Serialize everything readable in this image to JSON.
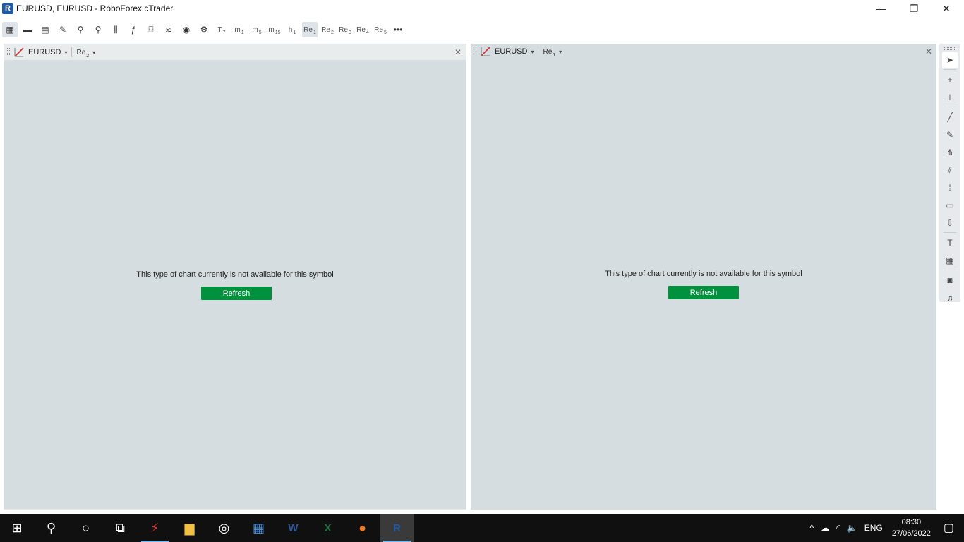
{
  "window": {
    "title": "EURUSD, EURUSD - RoboForex cTrader",
    "icon_letter": "R",
    "minimize": "—",
    "restore": "❐",
    "close": "✕"
  },
  "toolbar": {
    "tools": [
      {
        "icon": "multi-chart-icon",
        "glyph": "▦"
      },
      {
        "icon": "single-chart-icon",
        "glyph": "▬"
      },
      {
        "icon": "layout-icon",
        "glyph": "▤"
      },
      {
        "icon": "chart-settings-icon",
        "glyph": "✎"
      },
      {
        "icon": "zoom-out-icon",
        "glyph": "⚲"
      },
      {
        "icon": "zoom-in-icon",
        "glyph": "⚲"
      },
      {
        "icon": "chart-type-icon",
        "glyph": "⫼"
      },
      {
        "icon": "indicators-icon",
        "glyph": "ƒ"
      },
      {
        "icon": "robots-icon",
        "glyph": "⌼"
      },
      {
        "icon": "layers-icon",
        "glyph": "≋"
      },
      {
        "icon": "watch-icon",
        "glyph": "◉"
      },
      {
        "icon": "template-icon",
        "glyph": "⚙"
      }
    ],
    "periods": [
      {
        "label": "T",
        "sub": "7"
      },
      {
        "label": "m",
        "sub": "1"
      },
      {
        "label": "m",
        "sub": "5"
      },
      {
        "label": "m",
        "sub": "15"
      },
      {
        "label": "h",
        "sub": "1"
      },
      {
        "label": "Re",
        "sub": "1",
        "active": true
      },
      {
        "label": "Re",
        "sub": "2"
      },
      {
        "label": "Re",
        "sub": "3"
      },
      {
        "label": "Re",
        "sub": "4"
      },
      {
        "label": "Re",
        "sub": "5"
      }
    ],
    "more": "•••"
  },
  "panes": [
    {
      "symbol": "EURUSD",
      "period": "Re",
      "period_sub": "2",
      "message": "This type of chart currently is not available for this symbol",
      "button": "Refresh",
      "close": "✕"
    },
    {
      "symbol": "EURUSD",
      "period": "Re",
      "period_sub": "1",
      "message": "This type of chart currently is not available for this symbol",
      "button": "Refresh",
      "close": "✕"
    }
  ],
  "caret": "▾",
  "side_tools": [
    {
      "icon": "cursor-icon",
      "glyph": "➤",
      "active": true
    },
    {
      "icon": "crosshair-icon",
      "glyph": "+"
    },
    {
      "icon": "measure-icon",
      "glyph": "⊥"
    },
    {
      "icon": "trendline-icon",
      "glyph": "╱"
    },
    {
      "icon": "pen-icon",
      "glyph": "✎"
    },
    {
      "icon": "pitchfork-icon",
      "glyph": "⋔"
    },
    {
      "icon": "channel-icon",
      "glyph": "⫽"
    },
    {
      "icon": "fibonacci-icon",
      "glyph": "⁞"
    },
    {
      "icon": "rectangle-icon",
      "glyph": "▭"
    },
    {
      "icon": "arrow-icon",
      "glyph": "⇩"
    },
    {
      "icon": "text-icon",
      "glyph": "T"
    },
    {
      "icon": "pattern-icon",
      "glyph": "▦"
    },
    {
      "icon": "camera-icon",
      "glyph": "◙"
    },
    {
      "icon": "bell-icon",
      "glyph": "♫"
    }
  ],
  "taskbar": {
    "apps": [
      {
        "icon": "windows-start-icon",
        "glyph": "⊞"
      },
      {
        "icon": "search-icon",
        "glyph": "⚲"
      },
      {
        "icon": "cortana-icon",
        "glyph": "○"
      },
      {
        "icon": "task-view-icon",
        "glyph": "⧉"
      },
      {
        "icon": "lightning-app-icon",
        "glyph": "⚡",
        "color": "#e0312f",
        "running": true
      },
      {
        "icon": "file-explorer-icon",
        "glyph": "▆",
        "color": "#f2c042"
      },
      {
        "icon": "lamp-app-icon",
        "glyph": "◎"
      },
      {
        "icon": "calculator-icon",
        "glyph": "▦",
        "color": "#4a8bd6"
      },
      {
        "icon": "word-icon",
        "glyph": "W",
        "color": "#2b5797"
      },
      {
        "icon": "excel-icon",
        "glyph": "X",
        "color": "#1d7044"
      },
      {
        "icon": "firefox-icon",
        "glyph": "●",
        "color": "#f07a20"
      },
      {
        "icon": "ctrader-icon",
        "glyph": "R",
        "color": "#1f5aa6",
        "running": true,
        "active": true
      }
    ],
    "tray": {
      "chevron": "^",
      "cloud": "☁",
      "wifi": "◜",
      "volume": "🔈",
      "language": "ENG",
      "time": "08:30",
      "date": "27/06/2022",
      "notifications": "▢"
    }
  }
}
